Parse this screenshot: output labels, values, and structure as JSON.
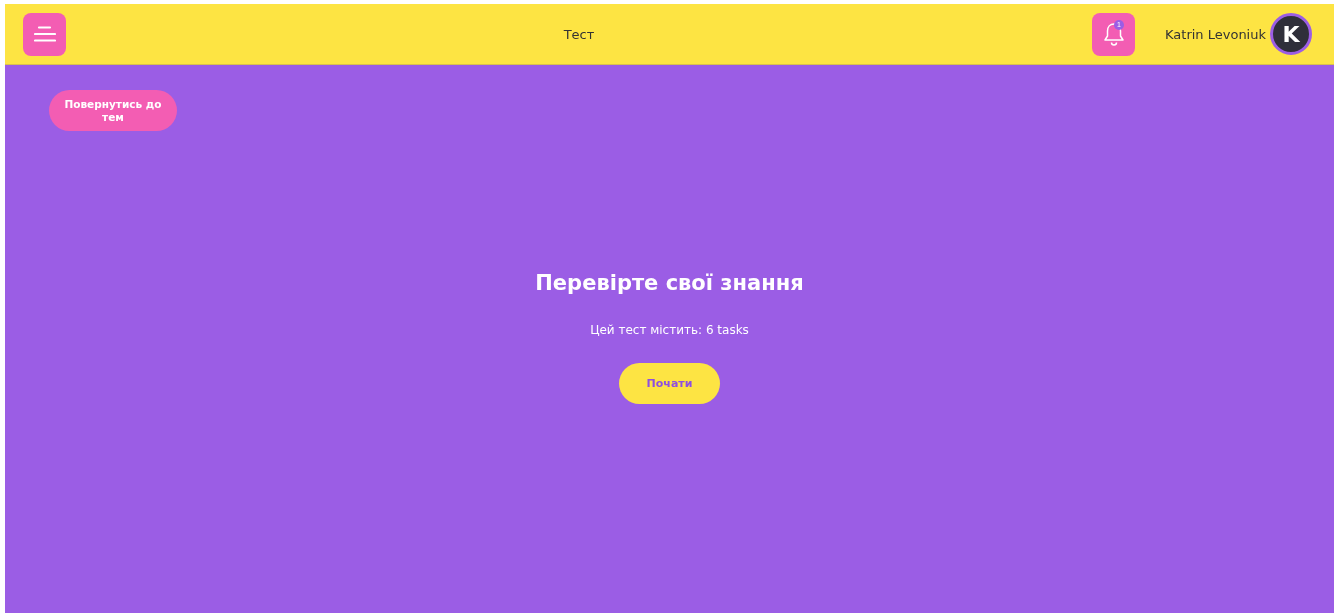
{
  "header": {
    "title": "Тест",
    "notifications": {
      "badge": "1"
    },
    "user": {
      "name": "Katrin Levoniuk",
      "avatar_letter": "K"
    }
  },
  "back_button": {
    "label": "Повернутись до тем"
  },
  "intro": {
    "heading": "Перевірте свої знання",
    "description": "Цей тест містить: 6 tasks",
    "start_button": "Почати"
  }
}
